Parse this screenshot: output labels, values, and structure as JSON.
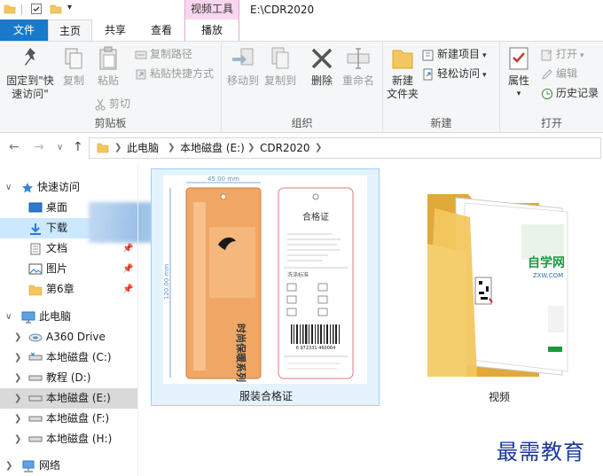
{
  "titlebar": {
    "context_tab": "视频工具",
    "window_title": "E:\\CDR2020"
  },
  "tabs": {
    "file": "文件",
    "home": "主页",
    "share": "共享",
    "view": "查看",
    "play": "播放"
  },
  "ribbon": {
    "clipboard": {
      "label": "剪贴板",
      "pin_quick_line1": "固定到\"快",
      "pin_quick_line2": "速访问\"",
      "copy": "复制",
      "paste": "粘贴",
      "copy_path": "复制路径",
      "paste_shortcut": "粘贴快捷方式",
      "cut": "剪切"
    },
    "organize": {
      "label": "组织",
      "move_to": "移动到",
      "copy_to": "复制到",
      "delete": "删除",
      "rename": "重命名"
    },
    "new": {
      "label": "新建",
      "new_folder_line1": "新建",
      "new_folder_line2": "文件夹",
      "new_item": "新建项目",
      "easy_access": "轻松访问"
    },
    "open": {
      "label": "打开",
      "properties": "属性",
      "open": "打开",
      "edit": "编辑",
      "history": "历史记录"
    }
  },
  "address": {
    "crumbs": [
      "此电脑",
      "本地磁盘 (E:)",
      "CDR2020"
    ]
  },
  "nav": {
    "quick_access": "快速访问",
    "desktop": "桌面",
    "downloads": "下载",
    "documents": "文档",
    "pictures": "图片",
    "chapter6": "第6章",
    "this_pc": "此电脑",
    "a360": "A360 Drive",
    "drive_c": "本地磁盘 (C:)",
    "drive_d": "教程 (D:)",
    "drive_e": "本地磁盘 (E:)",
    "drive_f": "本地磁盘 (F:)",
    "drive_h": "本地磁盘 (H:)",
    "network": "网络"
  },
  "files": [
    {
      "name": "服装合格证"
    },
    {
      "name": "视频"
    }
  ],
  "thumbnail": {
    "dim_top": "45.00 mm",
    "dim_side": "120.00 mm",
    "cert_title": "合格证",
    "wash_label": "洗涤标准",
    "tag_text": "时尚保暖系列",
    "barcode_digits": "6 972331 460064"
  },
  "folder_thumb": {
    "brand_text": "自学网",
    "brand_url": "ZXW.COM"
  },
  "watermark": "最需教育",
  "colors": {
    "accent": "#1979ca",
    "context_tab": "#f8d6ee",
    "selection": "#cce8ff",
    "tag_orange": "#f0a766",
    "folder": "#f3c65f"
  }
}
